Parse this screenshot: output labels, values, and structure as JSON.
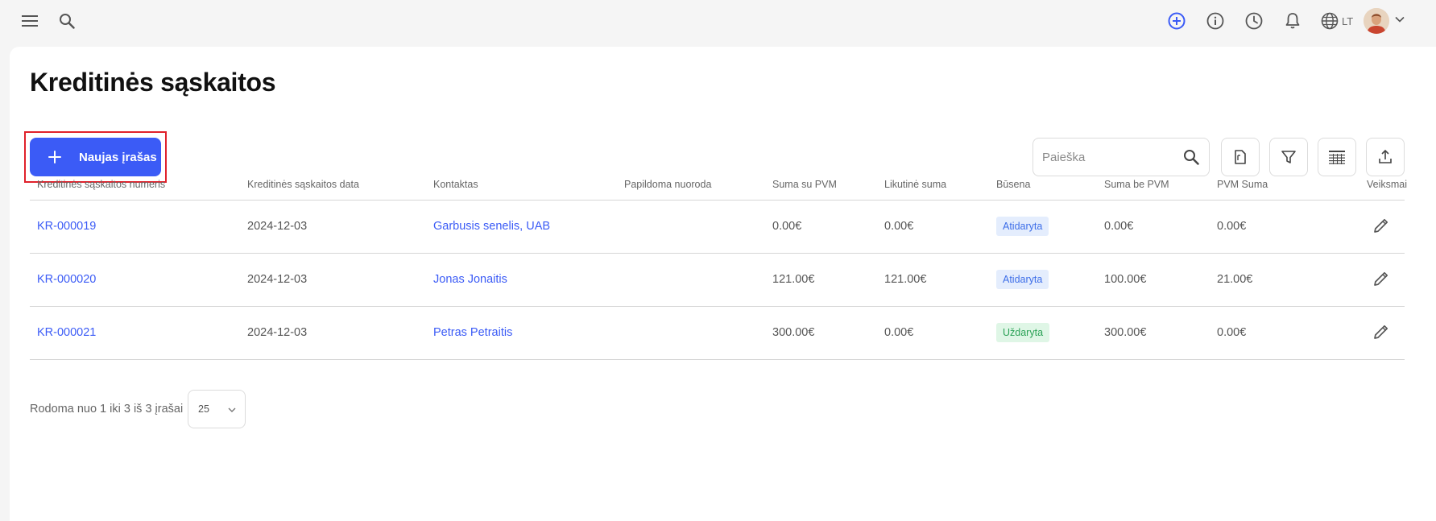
{
  "header": {
    "menu_icon": "hamburger-menu-icon",
    "search_icon": "search-icon",
    "actions": [
      "add-circle-icon",
      "info-icon",
      "clock-icon",
      "bell-icon",
      "globe-icon"
    ],
    "language": "LT",
    "accent_color": "#3b5bf6"
  },
  "page": {
    "title": "Kreditinės sąskaitos",
    "new_button_label": "Naujas įrašas",
    "search_placeholder": "Paieška",
    "toolbar_icons": [
      "document-icon",
      "filter-icon",
      "columns-icon",
      "export-icon"
    ]
  },
  "table": {
    "columns": {
      "number": "Kreditinės sąskaitos numeris",
      "date": "Kreditinės sąskaitos data",
      "contact": "Kontaktas",
      "reference": "Papildoma nuoroda",
      "total_vat": "Suma su PVM",
      "balance": "Likutinė suma",
      "status": "Būsena",
      "total_no_vat": "Suma be PVM",
      "vat": "PVM Suma",
      "actions": "Veiksmai"
    },
    "rows": [
      {
        "number": "KR-000019",
        "date": "2024-12-03",
        "contact": "Garbusis senelis, UAB",
        "reference": "",
        "total_vat": "0.00€",
        "balance": "0.00€",
        "status": "Atidaryta",
        "status_type": "open",
        "total_no_vat": "0.00€",
        "vat": "0.00€"
      },
      {
        "number": "KR-000020",
        "date": "2024-12-03",
        "contact": "Jonas Jonaitis",
        "reference": "",
        "total_vat": "121.00€",
        "balance": "121.00€",
        "status": "Atidaryta",
        "status_type": "open",
        "total_no_vat": "100.00€",
        "vat": "21.00€"
      },
      {
        "number": "KR-000021",
        "date": "2024-12-03",
        "contact": "Petras Petraitis",
        "reference": "",
        "total_vat": "300.00€",
        "balance": "0.00€",
        "status": "Uždaryta",
        "status_type": "closed",
        "total_no_vat": "300.00€",
        "vat": "0.00€"
      }
    ]
  },
  "footer": {
    "pager_text": "Rodoma nuo 1 iki 3 iš 3 įrašai",
    "page_size": "25"
  }
}
